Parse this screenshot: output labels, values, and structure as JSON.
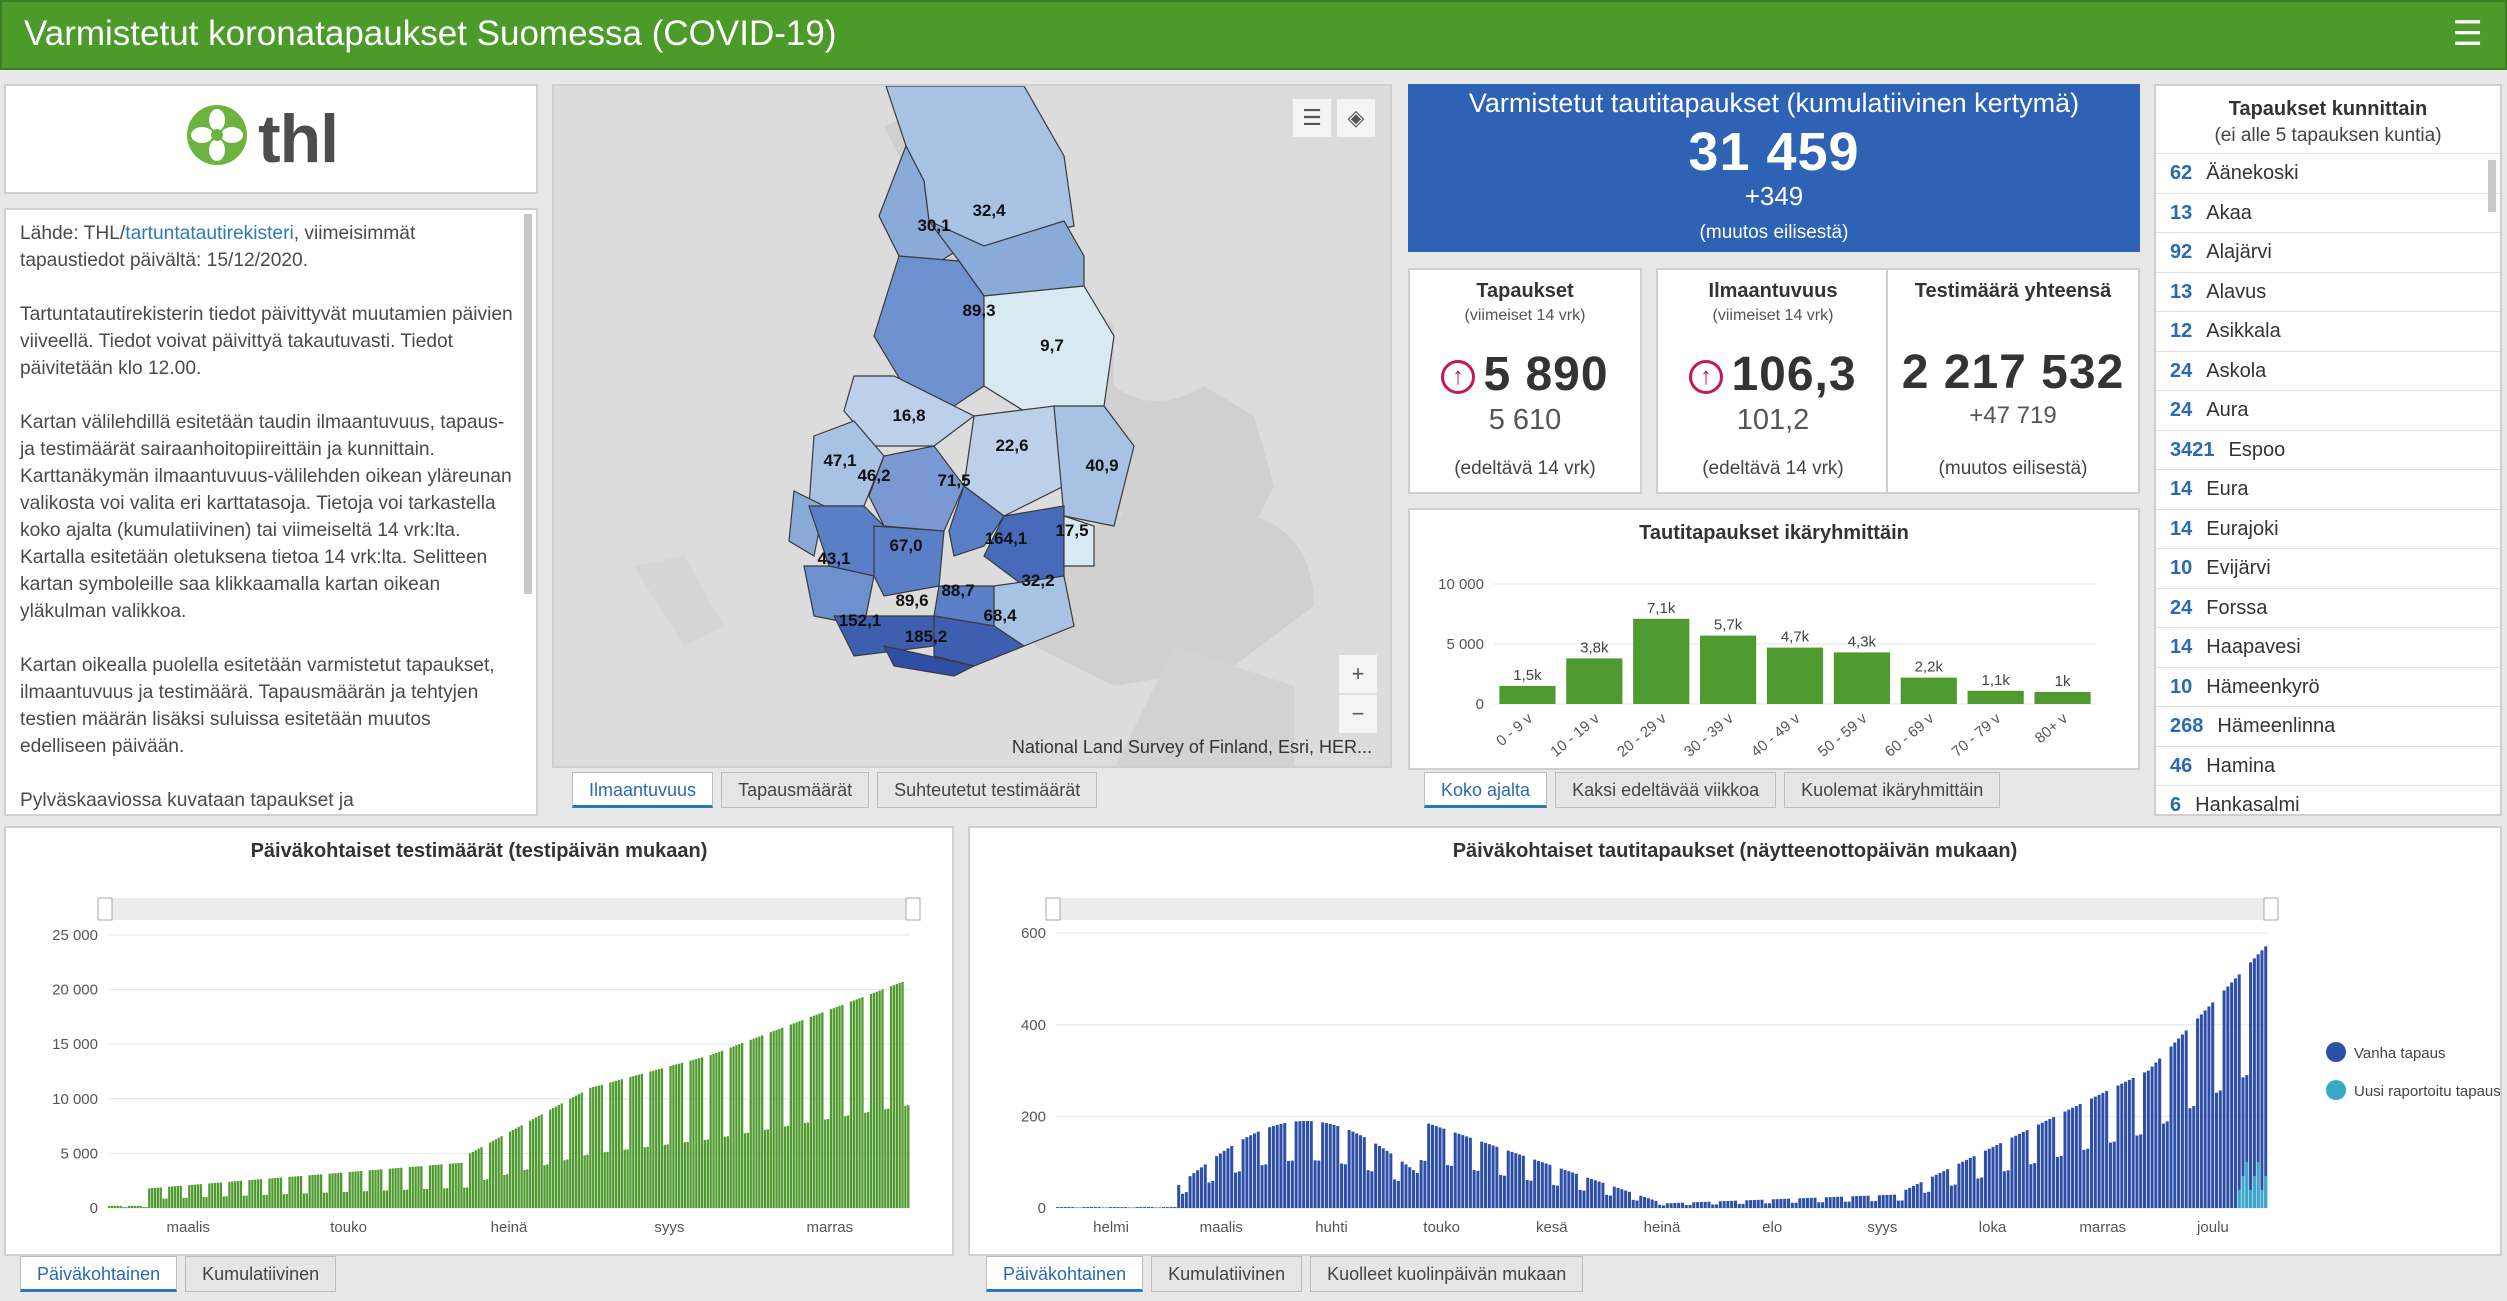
{
  "header": {
    "title": "Varmistetut koronatapaukset Suomessa (COVID-19)",
    "menu_icon": "hamburger-icon"
  },
  "logo": {
    "text": "thl"
  },
  "info": {
    "p1_a": "Lähde: THL/",
    "p1_link": "tartuntatautirekisteri",
    "p1_b": ", viimeisimmät tapaustiedot päivältä: 15/12/2020.",
    "p2": "Tartuntatautirekisterin tiedot päivittyvät muutamien päivien viiveellä. Tiedot voivat päivittyä takautuvasti. Tiedot päivitetään klo 12.00.",
    "p3": "Kartan välilehdillä esitetään taudin ilmaantuvuus, tapaus- ja testimäärät sairaanhoitopiireittäin ja kunnittain. Karttanäkymän ilmaantuvuus-välilehden oikean yläreunan valikosta voi valita eri karttatasoja. Tietoja voi tarkastella koko ajalta (kumulatiivinen) tai viimeiseltä 14 vrk:lta. Kartalla esitetään oletuksena tietoa 14 vrk:lta. Selitteen kartan symboleille saa klikkaamalla kartan oikean yläkulman valikkoa.",
    "p4": "Kartan oikealla puolella esitetään varmistetut tapaukset, ilmaantuvuus ja testimäärä. Tapausmäärän ja tehtyjen testien määrän lisäksi suluissa esitetään muutos edelliseen päivään.",
    "p5": "Pylväskaaviossa kuvataan tapaukset ja kuolemantapaukset ikäryhmittäin. Taulukossa tapaukset näkyvät kunnittain."
  },
  "map": {
    "attribution": "National Land Survey of Finland, Esri, HER...",
    "labels": [
      "32,4",
      "30,1",
      "89,3",
      "9,7",
      "16,8",
      "22,6",
      "40,9",
      "46,2",
      "71,5",
      "47,1",
      "67,0",
      "164,1",
      "17,5",
      "43,1",
      "89,6",
      "88,7",
      "32,2",
      "152,1",
      "68,4",
      "185,2"
    ],
    "tabs": [
      "Ilmaantuvuus",
      "Tapausmäärät",
      "Suhteutetut testimäärät"
    ]
  },
  "kpi_main": {
    "title": "Varmistetut tautitapaukset (kumulatiivinen kertymä)",
    "value": "31 459",
    "change": "+349",
    "note": "(muutos eilisestä)"
  },
  "kpi1": {
    "title": "Tapaukset",
    "sub": "(viimeiset 14 vrk)",
    "value": "5 890",
    "prev": "5 610",
    "foot": "(edeltävä 14 vrk)"
  },
  "kpi2": {
    "title": "Ilmaantuvuus",
    "sub": "(viimeiset 14 vrk)",
    "value": "106,3",
    "prev": "101,2",
    "foot": "(edeltävä 14 vrk)"
  },
  "kpi3": {
    "title": "Testimäärä yhteensä",
    "value": "2 217 532",
    "prev": "+47 719",
    "foot": "(muutos eilisestä)"
  },
  "list": {
    "title": "Tapaukset kunnittain",
    "subtitle": "(ei alle 5 tapauksen kuntia)",
    "items": [
      [
        "62",
        "Äänekoski"
      ],
      [
        "13",
        "Akaa"
      ],
      [
        "92",
        "Alajärvi"
      ],
      [
        "13",
        "Alavus"
      ],
      [
        "12",
        "Asikkala"
      ],
      [
        "24",
        "Askola"
      ],
      [
        "24",
        "Aura"
      ],
      [
        "3421",
        "Espoo"
      ],
      [
        "14",
        "Eura"
      ],
      [
        "14",
        "Eurajoki"
      ],
      [
        "10",
        "Evijärvi"
      ],
      [
        "24",
        "Forssa"
      ],
      [
        "14",
        "Haapavesi"
      ],
      [
        "10",
        "Hämeenkyrö"
      ],
      [
        "268",
        "Hämeenlinna"
      ],
      [
        "46",
        "Hamina"
      ],
      [
        "6",
        "Hankasalmi"
      ]
    ]
  },
  "age_tabs": [
    "Koko ajalta",
    "Kaksi edeltävää viikkoa",
    "Kuolemat ikäryhmittäin"
  ],
  "test_tabs": [
    "Päiväkohtainen",
    "Kumulatiivinen"
  ],
  "case_tabs": [
    "Päiväkohtainen",
    "Kumulatiivinen",
    "Kuolleet kuolinpäivän mukaan"
  ],
  "legend": {
    "old": "Vanha tapaus",
    "new": "Uusi raportoitu tapaus",
    "old_color": "#2d4fa8",
    "new_color": "#3aa9c9"
  },
  "chart_data": [
    {
      "type": "bar",
      "title": "Tautitapaukset ikäryhmittäin",
      "categories": [
        "0 - 9 v",
        "10 - 19 v",
        "20 - 29 v",
        "30 - 39 v",
        "40 - 49 v",
        "50 - 59 v",
        "60 - 69 v",
        "70 - 79 v",
        "80+ v"
      ],
      "values": [
        1500,
        3800,
        7100,
        5700,
        4700,
        4300,
        2200,
        1100,
        1000
      ],
      "data_labels": [
        "1,5k",
        "3,8k",
        "7,1k",
        "5,7k",
        "4,7k",
        "4,3k",
        "2,2k",
        "1,1k",
        "1k"
      ],
      "yticks": [
        "0",
        "5 000",
        "10 000"
      ],
      "ylim": [
        0,
        10000
      ],
      "color": "#4e9a2f"
    },
    {
      "type": "bar",
      "title": "Päiväkohtaiset testimäärät (testipäivän mukaan)",
      "xticks": [
        "maalis",
        "touko",
        "heinä",
        "syys",
        "marras"
      ],
      "yticks": [
        "0",
        "5 000",
        "10 000",
        "15 000",
        "20 000",
        "25 000"
      ],
      "ylim": [
        0,
        26000
      ],
      "color": "#4e9a2f"
    },
    {
      "type": "bar",
      "title": "Päiväkohtaiset tautitapaukset (näytteenottopäivän mukaan)",
      "xticks": [
        "helmi",
        "maalis",
        "huhti",
        "touko",
        "kesä",
        "heinä",
        "elo",
        "syys",
        "loka",
        "marras",
        "joulu"
      ],
      "yticks": [
        "0",
        "200",
        "400",
        "600"
      ],
      "ylim": [
        0,
        620
      ],
      "series": [
        {
          "name": "Vanha tapaus"
        },
        {
          "name": "Uusi raportoitu tapaus"
        }
      ]
    }
  ]
}
